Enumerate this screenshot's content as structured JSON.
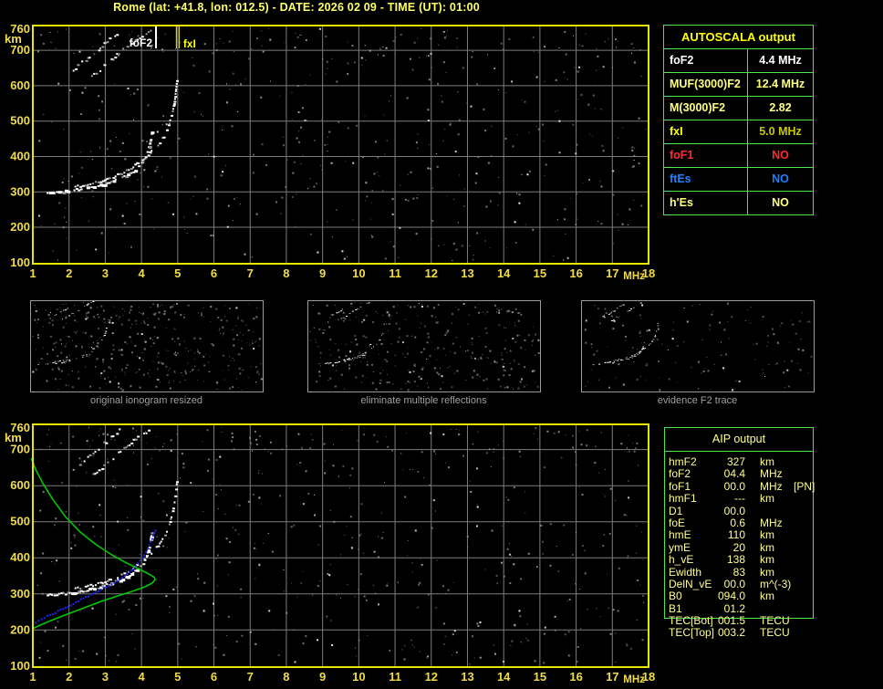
{
  "title": "Rome (lat: +41.8, lon: 012.5) - DATE: 2026 02 09 - TIME (UT): 01:00",
  "autoscala": {
    "header": "AUTOSCALA output",
    "rows": [
      {
        "label": "foF2",
        "value": "4.4 MHz",
        "color": "#ffffff"
      },
      {
        "label": "MUF(3000)F2",
        "value": "12.4 MHz",
        "color": "#ffff7f"
      },
      {
        "label": "M(3000)F2",
        "value": "2.82",
        "color": "#ffff7f"
      },
      {
        "label": "fxI",
        "value": "5.0 MHz",
        "color": "#ffff00",
        "value_color": "#c8c800"
      },
      {
        "label": "foF1",
        "value": "NO",
        "color": "#ff2a2a"
      },
      {
        "label": "ftEs",
        "value": "NO",
        "color": "#1e7fff"
      },
      {
        "label": "h'Es",
        "value": "NO",
        "color": "#ffff7f"
      }
    ]
  },
  "aip": {
    "header": "AIP output",
    "rows": [
      {
        "param": "hmF2",
        "value": "327",
        "unit": "km",
        "note": ""
      },
      {
        "param": "foF2",
        "value": "04.4",
        "unit": "MHz",
        "note": ""
      },
      {
        "param": "foF1",
        "value": "00.0",
        "unit": "MHz",
        "note": "[PN]"
      },
      {
        "param": "hmF1",
        "value": "---",
        "unit": "km",
        "note": ""
      },
      {
        "param": "D1",
        "value": "00.0",
        "unit": "",
        "note": ""
      },
      {
        "param": "foE",
        "value": "0.6",
        "unit": "MHz",
        "note": ""
      },
      {
        "param": "hmE",
        "value": "110",
        "unit": "km",
        "note": ""
      },
      {
        "param": "ymE",
        "value": "20",
        "unit": "km",
        "note": ""
      },
      {
        "param": "h_vE",
        "value": "138",
        "unit": "km",
        "note": ""
      },
      {
        "param": "Ewidth",
        "value": "83",
        "unit": "km",
        "note": ""
      },
      {
        "param": "DelN_vE",
        "value": "00.0",
        "unit": "m^(-3)",
        "note": ""
      },
      {
        "param": "B0",
        "value": "094.0",
        "unit": "km",
        "note": ""
      },
      {
        "param": "B1",
        "value": "01.2",
        "unit": "",
        "note": ""
      },
      {
        "param": "TEC[Bot]",
        "value": "001.5",
        "unit": "TECU",
        "note": ""
      },
      {
        "param": "TEC[Top]",
        "value": "003.2",
        "unit": "TECU",
        "note": ""
      }
    ]
  },
  "thumbnails": [
    {
      "caption": "original ionogram resized"
    },
    {
      "caption": "eliminate multiple reflections"
    },
    {
      "caption": "evidence F2 trace"
    }
  ],
  "chart_data": {
    "type": "scatter",
    "title": "Ionogram with autoscaled parameters",
    "xlabel": "MHz",
    "ylabel": "km",
    "x_ticks": [
      1,
      2,
      3,
      4,
      5,
      6,
      7,
      8,
      9,
      10,
      11,
      12,
      13,
      14,
      15,
      16,
      17,
      18
    ],
    "y_ticks": [
      760,
      700,
      600,
      500,
      400,
      300,
      200,
      100
    ],
    "xlim": [
      1,
      18
    ],
    "ylim": [
      97,
      770
    ],
    "markers": [
      {
        "name": "foF2",
        "mhz": 4.4,
        "color": "#ffffff"
      },
      {
        "name": "fxI",
        "mhz": 5.0,
        "color": "#ffff00"
      }
    ],
    "traces": {
      "f2_ordinary": [
        [
          1.38,
          300
        ],
        [
          1.7,
          302
        ],
        [
          2.0,
          305
        ],
        [
          2.3,
          309
        ],
        [
          2.6,
          315
        ],
        [
          2.9,
          323
        ],
        [
          3.2,
          333
        ],
        [
          3.45,
          344
        ],
        [
          3.7,
          357
        ],
        [
          3.9,
          372
        ],
        [
          4.03,
          388
        ],
        [
          4.12,
          408
        ],
        [
          4.19,
          432
        ],
        [
          4.24,
          458
        ],
        [
          4.27,
          478
        ]
      ],
      "f2_extraordinary": [
        [
          2.15,
          316
        ],
        [
          2.5,
          323
        ],
        [
          2.85,
          332
        ],
        [
          3.2,
          344
        ],
        [
          3.5,
          358
        ],
        [
          3.75,
          373
        ],
        [
          3.95,
          389
        ],
        [
          4.12,
          404
        ],
        [
          4.3,
          421
        ],
        [
          4.48,
          441
        ],
        [
          4.63,
          465
        ],
        [
          4.75,
          495
        ],
        [
          4.84,
          530
        ],
        [
          4.9,
          565
        ],
        [
          4.94,
          598
        ],
        [
          4.96,
          622
        ]
      ],
      "second_hop_a": [
        [
          2.1,
          648
        ],
        [
          2.4,
          672
        ],
        [
          2.7,
          698
        ],
        [
          3.0,
          724
        ],
        [
          3.3,
          750
        ],
        [
          3.45,
          762
        ]
      ],
      "second_hop_b": [
        [
          2.55,
          622
        ],
        [
          2.9,
          652
        ],
        [
          3.3,
          688
        ],
        [
          3.7,
          722
        ],
        [
          4.05,
          748
        ],
        [
          4.3,
          762
        ]
      ],
      "profile_green": [
        [
          0.96,
          676
        ],
        [
          1.08,
          644
        ],
        [
          1.28,
          606
        ],
        [
          1.55,
          562
        ],
        [
          1.9,
          514
        ],
        [
          2.3,
          472
        ],
        [
          2.75,
          436
        ],
        [
          3.2,
          407
        ],
        [
          3.6,
          385
        ],
        [
          3.95,
          368
        ],
        [
          4.2,
          355
        ],
        [
          4.35,
          346
        ],
        [
          4.38,
          340
        ],
        [
          4.3,
          330
        ],
        [
          4.1,
          320
        ],
        [
          3.8,
          309
        ],
        [
          3.4,
          296
        ],
        [
          2.9,
          280
        ],
        [
          2.35,
          259
        ],
        [
          1.85,
          240
        ],
        [
          1.45,
          224
        ],
        [
          1.15,
          211
        ],
        [
          0.98,
          203
        ]
      ],
      "restored_trace_blue": [
        [
          1.05,
          222
        ],
        [
          1.3,
          236
        ],
        [
          1.6,
          251
        ],
        [
          1.95,
          268
        ],
        [
          2.3,
          286
        ],
        [
          2.65,
          304
        ],
        [
          3.0,
          322
        ],
        [
          3.3,
          339
        ],
        [
          3.58,
          357
        ],
        [
          3.82,
          378
        ],
        [
          4.0,
          402
        ],
        [
          4.15,
          428
        ],
        [
          4.27,
          455
        ],
        [
          4.36,
          478
        ],
        [
          4.4,
          491
        ]
      ]
    }
  },
  "colors": {
    "background": "#000000",
    "plot_border": "#e6e600",
    "grid": "#7d7d7d",
    "axis_label": "#f0dc46",
    "title": "#ffff66",
    "table_border": "#4ce64c",
    "autoscala_header": "#ffff00",
    "aip_text": "#ffff8c",
    "thumb_border": "#9a9a9a",
    "caption_text": "#a0a0a0",
    "profile_green": "#00c800",
    "trace_blue": "#2222ee",
    "trace_white": "#ffffff"
  }
}
